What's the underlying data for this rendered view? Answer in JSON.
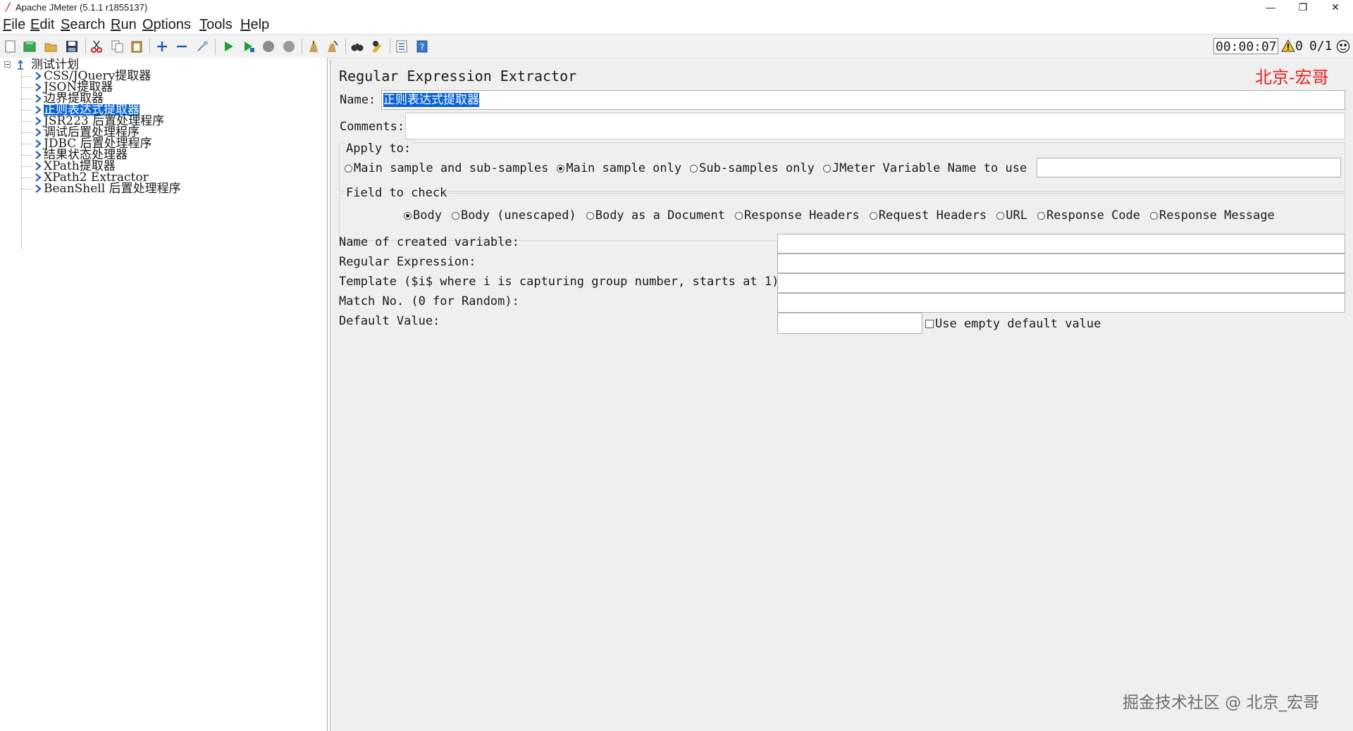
{
  "window": {
    "title": "Apache JMeter (5.1.1 r1855137)",
    "minimize": "—",
    "restore": "❐",
    "close": "✕"
  },
  "menu": [
    "File",
    "Edit",
    "Search",
    "Run",
    "Options",
    "Tools",
    "Help"
  ],
  "toolbar": {
    "timer": "00:00:07",
    "warnings": "0",
    "threads": "0/1",
    "icons": [
      "new-icon",
      "templates-icon",
      "open-icon",
      "save-icon",
      "cut-icon",
      "copy-icon",
      "paste-icon",
      "expand-icon",
      "collapse-icon",
      "toggle-icon",
      "start-icon",
      "start-no-pause-icon",
      "stop-icon",
      "shutdown-icon",
      "clear-icon",
      "clear-all-icon",
      "search-icon",
      "reset-search-icon",
      "function-helper-icon",
      "help-icon"
    ]
  },
  "tree": {
    "root": "测试计划",
    "items": [
      {
        "label": "CSS/JQuery提取器",
        "selected": false
      },
      {
        "label": "JSON提取器",
        "selected": false
      },
      {
        "label": "边界提取器",
        "selected": false
      },
      {
        "label": "正则表达式提取器",
        "selected": true
      },
      {
        "label": "JSR223 后置处理程序",
        "selected": false
      },
      {
        "label": "调试后置处理程序",
        "selected": false
      },
      {
        "label": "JDBC 后置处理程序",
        "selected": false
      },
      {
        "label": "结果状态处理器",
        "selected": false
      },
      {
        "label": "XPath提取器",
        "selected": false
      },
      {
        "label": "XPath2 Extractor",
        "selected": false
      },
      {
        "label": "BeanShell 后置处理程序",
        "selected": false
      }
    ]
  },
  "panel": {
    "heading": "Regular Expression Extractor",
    "name_label": "Name:",
    "name_value": "正则表达式提取器",
    "comments_label": "Comments:",
    "comments_value": "",
    "apply_to": {
      "label": "Apply to:",
      "options": [
        "Main sample and sub-samples",
        "Main sample only",
        "Sub-samples only",
        "JMeter Variable Name to use"
      ],
      "selected": "Main sample only",
      "variable_value": ""
    },
    "field_to_check": {
      "label": "Field to check",
      "options": [
        "Body",
        "Body (unescaped)",
        "Body as a Document",
        "Response Headers",
        "Request Headers",
        "URL",
        "Response Code",
        "Response Message"
      ],
      "selected": "Body"
    },
    "fields": {
      "variable_label": "Name of created variable:",
      "variable_value": "",
      "regex_label": "Regular Expression:",
      "regex_value": "",
      "template_label": "Template ($i$ where i is capturing group number, starts at 1):",
      "template_value": "",
      "match_label": "Match No. (0 for Random):",
      "match_value": "",
      "default_label": "Default Value:",
      "default_value": "",
      "empty_default_label": "Use empty default value",
      "empty_default_checked": false
    },
    "watermark_red": "北京-宏哥",
    "watermark_gray": "掘金技术社区 @ 北京_宏哥"
  },
  "colors": {
    "selection": "#0a64d2",
    "watermark_red": "#e02020",
    "panel_bg": "#efefef"
  }
}
